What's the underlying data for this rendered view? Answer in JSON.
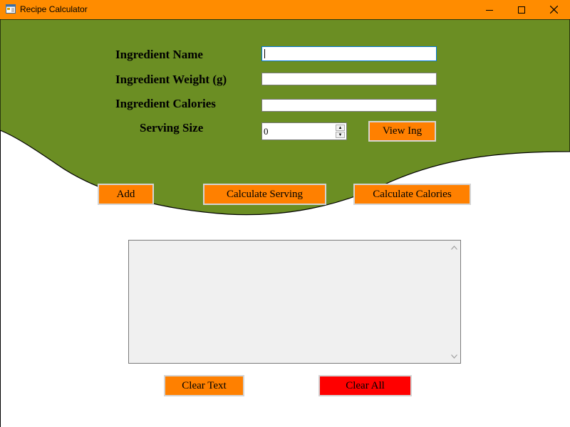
{
  "window": {
    "title": "Recipe Calculator",
    "controls": {
      "minimize": "minimize-icon",
      "maximize": "maximize-icon",
      "close": "close-icon"
    }
  },
  "form": {
    "ingredient_name_label": "Ingredient Name",
    "ingredient_weight_label": "Ingredient Weight (g)",
    "ingredient_calories_label": "Ingredient Calories",
    "serving_size_label": "Serving Size",
    "ingredient_name_value": "",
    "ingredient_weight_value": "",
    "ingredient_calories_value": "",
    "serving_size_value": "0"
  },
  "buttons": {
    "view_ing": "View Ing",
    "add": "Add",
    "calculate_serving": "Calculate Serving",
    "calculate_calories": "Calculate Calories",
    "clear_text": "Clear Text",
    "clear_all": "Clear All"
  },
  "output": {
    "text": ""
  },
  "colors": {
    "titlebar": "#ff8c00",
    "banner_green": "#6b8e23",
    "button_orange": "#ff8000",
    "button_red": "#ff0000",
    "output_bg": "#f0f0f0"
  }
}
